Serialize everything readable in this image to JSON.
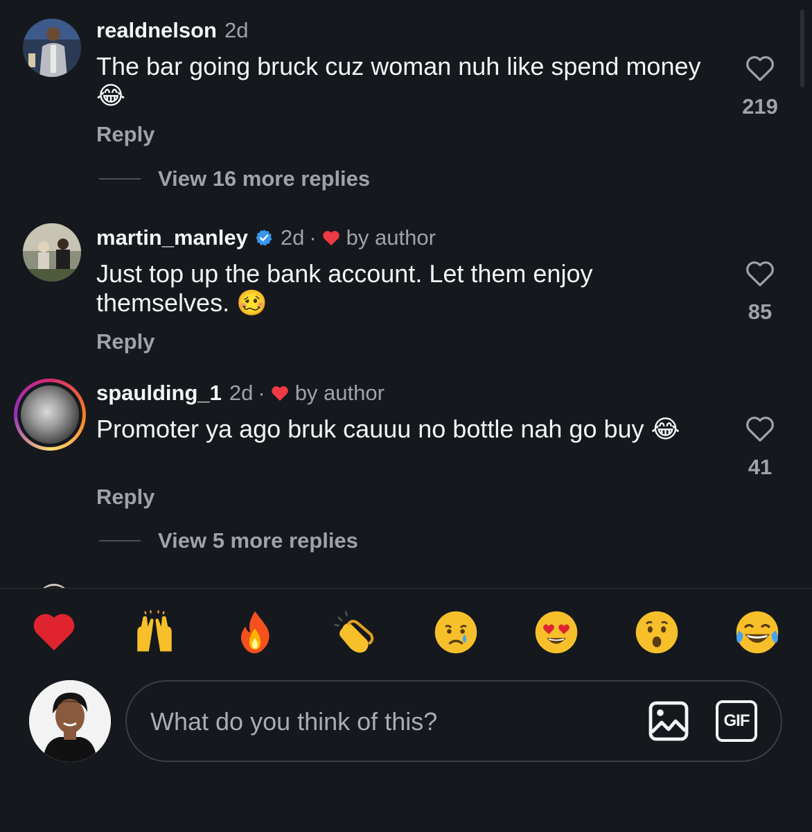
{
  "comments": [
    {
      "username": "realdnelson",
      "time": "2d",
      "verified": false,
      "liked_by_author": false,
      "text": "The bar going bruck cuz woman nuh like spend money 😂",
      "reply_label": "Reply",
      "likes": "219",
      "more_replies": "View 16 more replies"
    },
    {
      "username": "martin_manley",
      "time": "2d",
      "verified": true,
      "liked_by_author": true,
      "by_author_label": "by author",
      "text": "Just top up the bank account. Let them enjoy themselves. 🥴",
      "reply_label": "Reply",
      "likes": "85"
    },
    {
      "username": "spaulding_1",
      "time": "2d",
      "verified": false,
      "liked_by_author": true,
      "by_author_label": "by author",
      "text": "Promoter ya ago bruk cauuu no bottle nah go buy 😂",
      "reply_label": "Reply",
      "likes": "41",
      "more_replies": "View 5 more replies"
    }
  ],
  "separator_dot": "·",
  "reactions": [
    "red-heart",
    "raising-hands",
    "fire",
    "clapping-hands",
    "crying-face",
    "heart-eyes",
    "surprised-face",
    "tears-of-joy"
  ],
  "composer": {
    "placeholder": "What do you think of this?",
    "gif_label": "GIF"
  },
  "colors": {
    "background": "#15191e",
    "primary_text": "#f4f5f7",
    "secondary_text": "#9ea3ab",
    "verified_blue": "#3897f0",
    "heart_red": "#ed3a45"
  }
}
